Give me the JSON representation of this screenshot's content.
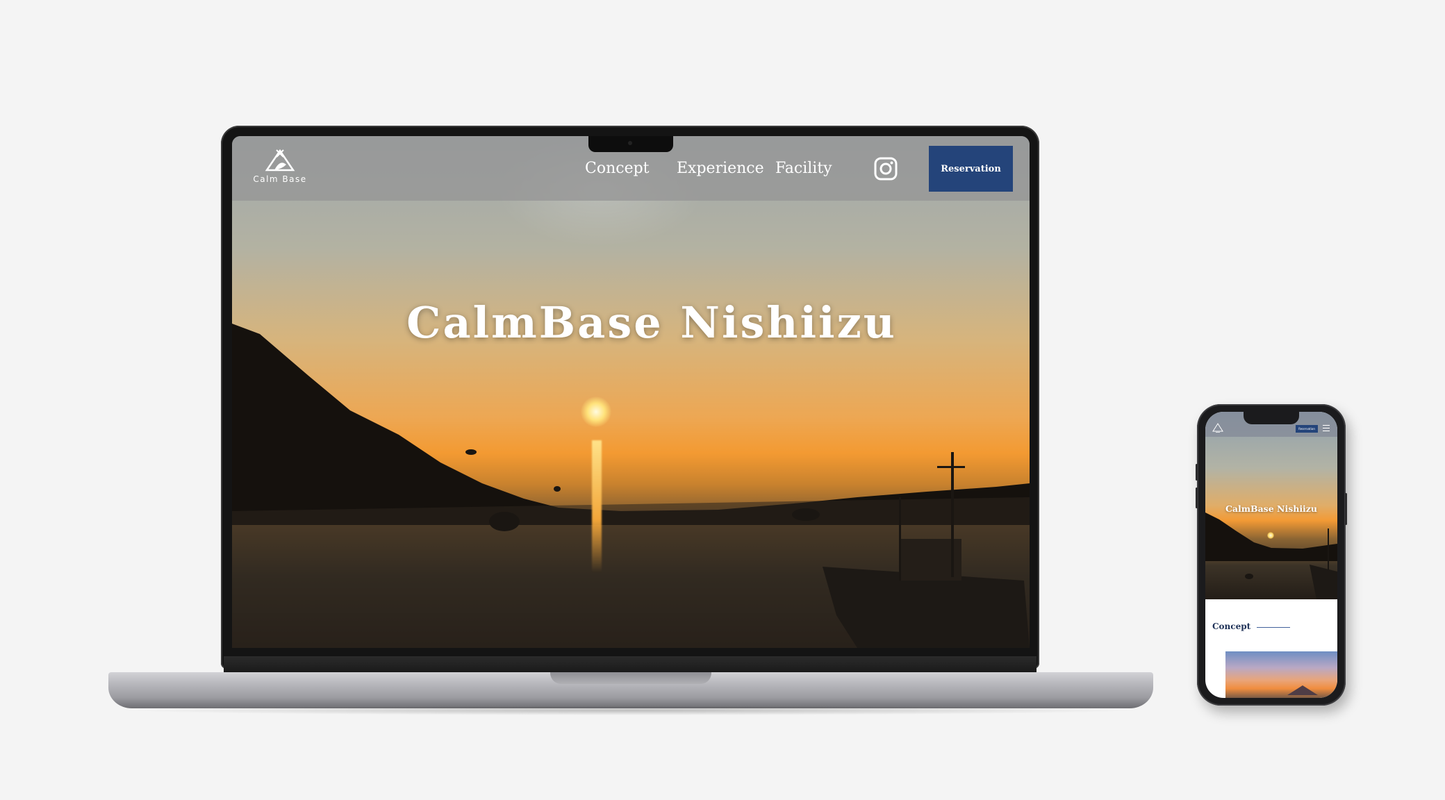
{
  "laptop": {
    "logo": {
      "icon": "tent-icon",
      "text": "Calm Base"
    },
    "nav": {
      "links": [
        "Concept",
        "Experience",
        "Facility"
      ],
      "instagram_icon": "instagram-icon",
      "reservation_label": "Reservation"
    },
    "hero": {
      "title": "CalmBase Nishiizu"
    }
  },
  "phone": {
    "logo_icon": "tent-icon",
    "reservation_label": "Reservation",
    "menu_icon": "hamburger-menu-icon",
    "hero": {
      "title": "CalmBase Nishiizu"
    },
    "section": {
      "title": "Concept"
    }
  },
  "colors": {
    "accent": "#24447a",
    "page_background": "#f4f4f4"
  }
}
